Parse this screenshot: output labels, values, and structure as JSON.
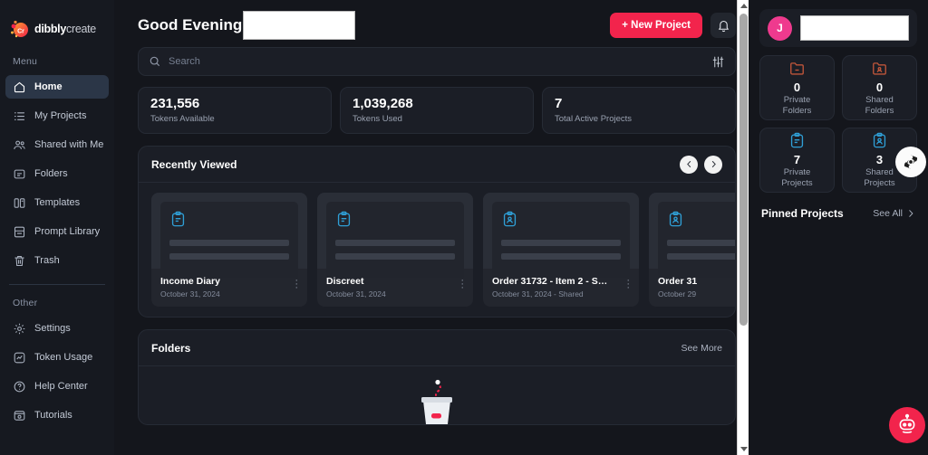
{
  "brand": {
    "name_bold": "dibbly",
    "name_light": "create",
    "logo_letters": "Cr"
  },
  "colors": {
    "accent_red": "#f2244c",
    "avatar_pink": "#ef3a8e",
    "folder_orange": "#c0563a",
    "project_blue": "#2f9fd6",
    "active_nav": "#2b3647"
  },
  "sidebar": {
    "menu_label": "Menu",
    "other_label": "Other",
    "menu_items": [
      {
        "label": "Home",
        "icon": "home-icon",
        "active": true
      },
      {
        "label": "My Projects",
        "icon": "list-icon",
        "active": false
      },
      {
        "label": "Shared with Me",
        "icon": "users-icon",
        "active": false
      },
      {
        "label": "Folders",
        "icon": "folder-icon",
        "active": false
      },
      {
        "label": "Templates",
        "icon": "templates-icon",
        "active": false
      },
      {
        "label": "Prompt Library",
        "icon": "book-icon",
        "active": false
      },
      {
        "label": "Trash",
        "icon": "trash-icon",
        "active": false
      }
    ],
    "other_items": [
      {
        "label": "Settings",
        "icon": "gear-icon"
      },
      {
        "label": "Token Usage",
        "icon": "chart-icon"
      },
      {
        "label": "Help Center",
        "icon": "question-icon"
      },
      {
        "label": "Tutorials",
        "icon": "video-icon"
      }
    ]
  },
  "header": {
    "greeting": "Good Evening,",
    "username_redacted": "",
    "new_project_label": "+ New Project",
    "bell_icon": "bell-icon"
  },
  "search": {
    "placeholder": "Search",
    "value": "",
    "icon": "search-icon",
    "filter_icon": "sliders-icon"
  },
  "stats": [
    {
      "value": "231,556",
      "label": "Tokens Available"
    },
    {
      "value": "1,039,268",
      "label": "Tokens Used"
    },
    {
      "value": "7",
      "label": "Total Active Projects"
    }
  ],
  "recently_viewed": {
    "title": "Recently Viewed",
    "prev_icon": "chevron-left-icon",
    "next_icon": "chevron-right-icon",
    "cards": [
      {
        "name": "Income Diary",
        "date": "October 31, 2024",
        "icon": "clipboard-icon"
      },
      {
        "name": "Discreet",
        "date": "October 31, 2024",
        "icon": "clipboard-icon"
      },
      {
        "name": "Order 31732 - Item 2 - Se...",
        "date": "October 31, 2024 - Shared",
        "icon": "clipboard-user-icon"
      },
      {
        "name": "Order 31",
        "date": "October 29",
        "icon": "clipboard-user-icon"
      }
    ]
  },
  "folders_section": {
    "title": "Folders",
    "see_more_label": "See More",
    "empty_icon": "empty-box-icon"
  },
  "right_panel": {
    "avatar_initial": "J",
    "username_redacted": "",
    "tiles": [
      {
        "value": "0",
        "label_line1": "Private",
        "label_line2": "Folders",
        "icon": "private-folder-icon"
      },
      {
        "value": "0",
        "label_line1": "Shared",
        "label_line2": "Folders",
        "icon": "shared-folder-icon"
      },
      {
        "value": "7",
        "label_line1": "Private",
        "label_line2": "Projects",
        "icon": "private-project-icon"
      },
      {
        "value": "3",
        "label_line1": "Shared",
        "label_line2": "Projects",
        "icon": "shared-project-icon"
      }
    ],
    "pinned_title": "Pinned Projects",
    "see_all_label": "See All",
    "see_all_icon": "chevron-right-icon"
  },
  "floating": {
    "pin_icon": "pinwheel-icon",
    "bot_icon": "robot-assistant-icon"
  }
}
